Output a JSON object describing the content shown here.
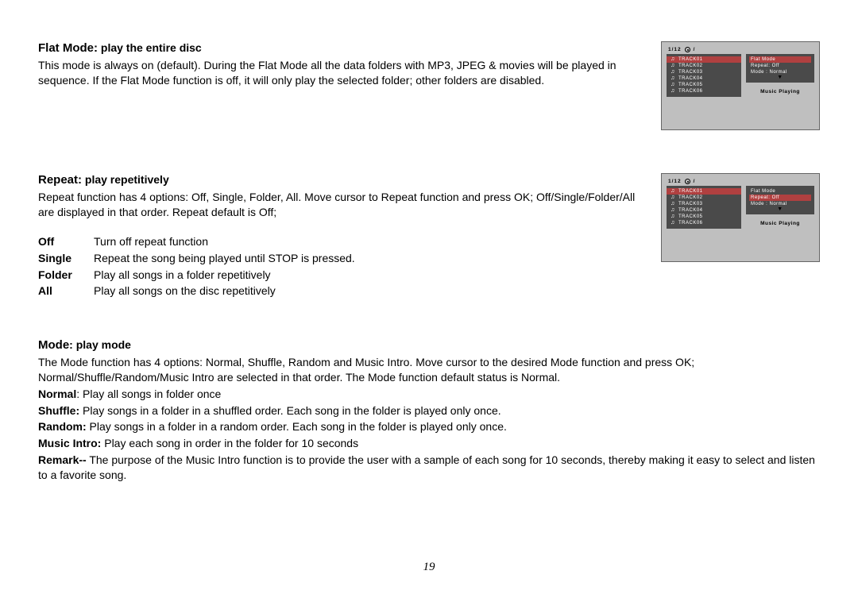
{
  "flat": {
    "h1": "Flat Mode:",
    "h2": " play the entire disc",
    "body": "This mode is always on (default). During the Flat Mode all the data folders with MP3, JPEG & movies will be played in sequence. If the Flat Mode function is off, it will only play the selected folder; other folders are disabled."
  },
  "repeat": {
    "h1": "Repeat:",
    "h2": " play repetitively",
    "body": "Repeat function has 4 options: Off, Single, Folder, All. Move cursor to Repeat function and press OK; Off/Single/Folder/All are displayed in that order. Repeat default is Off;",
    "off_t": "Off",
    "off_d": "Turn off repeat function",
    "single_t": "Single",
    "single_d": "Repeat the song being played until STOP is pressed.",
    "folder_t": "Folder",
    "folder_d": "Play all songs in a folder repetitively",
    "all_t": "All",
    "all_d": "Play all songs on the disc repetitively"
  },
  "mode": {
    "h1": "Mode",
    "h2": ": play mode",
    "body": "The Mode function has 4 options: Normal, Shuffle, Random and Music Intro.  Move cursor to the desired Mode function and press OK; Normal/Shuffle/Random/Music Intro are selected in that order. The Mode function default status is Normal.",
    "normal_t": "Normal",
    "normal_d": ":   Play all songs in folder once",
    "shuffle_t": "Shuffle:",
    "shuffle_d": "   Play songs in a folder in a shuffled order. Each song in the folder is played only once.",
    "random_t": "Random:",
    "random_d": "   Play songs in a folder in a random order. Each song in the folder is played only once.",
    "music_t": "Music Intro:",
    "music_d": "  Play each song in order in the folder for 10 seconds",
    "remark_t": "Remark--",
    "remark_d": " The purpose of the Music Intro function is to provide the user with a sample of each song for 10 seconds, thereby making it easy to select and listen to a favorite song."
  },
  "osd": {
    "counter": "1/12",
    "slash": "/",
    "tracks": [
      "TRACK01",
      "TRACK02",
      "TRACK03",
      "TRACK04",
      "TRACK05",
      "TRACK06"
    ],
    "flat": "Flat  Mode",
    "repeat": "Repeat:   Off",
    "mode": "Mode :   Normal",
    "arrow": "▼",
    "status": "Music Playing"
  },
  "page": "19"
}
